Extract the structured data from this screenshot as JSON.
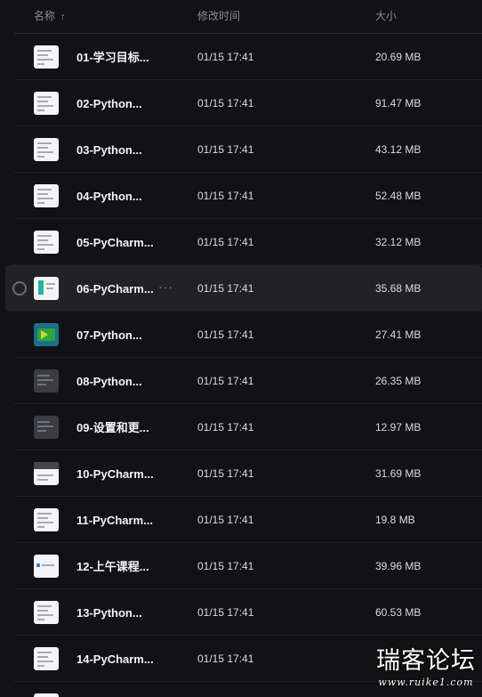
{
  "header": {
    "name_label": "名称",
    "sort_icon": "↑",
    "time_label": "修改时间",
    "size_label": "大小"
  },
  "files": [
    {
      "name": "01-学习目标...",
      "time": "01/15 17:41",
      "size": "20.69 MB",
      "thumb": "light"
    },
    {
      "name": "02-Python...",
      "time": "01/15 17:41",
      "size": "91.47 MB",
      "thumb": "light"
    },
    {
      "name": "03-Python...",
      "time": "01/15 17:41",
      "size": "43.12 MB",
      "thumb": "light"
    },
    {
      "name": "04-Python...",
      "time": "01/15 17:41",
      "size": "52.48 MB",
      "thumb": "light"
    },
    {
      "name": "05-PyCharm...",
      "time": "01/15 17:41",
      "size": "32.12 MB",
      "thumb": "light"
    },
    {
      "name": "06-PyCharm...",
      "time": "01/15 17:41",
      "size": "35.68 MB",
      "thumb": "teal",
      "hovered": true,
      "more": "···"
    },
    {
      "name": "07-Python...",
      "time": "01/15 17:41",
      "size": "27.41 MB",
      "thumb": "green"
    },
    {
      "name": "08-Python...",
      "time": "01/15 17:41",
      "size": "26.35 MB",
      "thumb": "dark"
    },
    {
      "name": "09-设置和更...",
      "time": "01/15 17:41",
      "size": "12.97 MB",
      "thumb": "dark"
    },
    {
      "name": "10-PyCharm...",
      "time": "01/15 17:41",
      "size": "31.69 MB",
      "thumb": "bar"
    },
    {
      "name": "11-PyCharm...",
      "time": "01/15 17:41",
      "size": "19.8 MB",
      "thumb": "light"
    },
    {
      "name": "12-上午课程...",
      "time": "01/15 17:41",
      "size": "39.96 MB",
      "thumb": "dot"
    },
    {
      "name": "13-Python...",
      "time": "01/15 17:41",
      "size": "60.53 MB",
      "thumb": "light"
    },
    {
      "name": "14-PyCharm...",
      "time": "01/15 17:41",
      "size": "",
      "thumb": "light"
    },
    {
      "name": "",
      "time": "",
      "size": "",
      "thumb": "light"
    }
  ],
  "watermark": {
    "main": "瑞客论坛",
    "sub": "www.ruike1.com"
  },
  "colors": {
    "background": "#121215",
    "hover_row": "#222226",
    "text": "#f2f2f4",
    "muted": "#8b8b92"
  }
}
